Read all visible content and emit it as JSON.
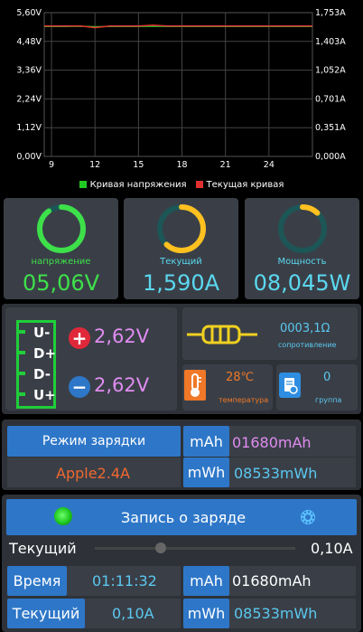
{
  "chart_data": {
    "type": "line",
    "x_ticks": [
      "9",
      "12",
      "15",
      "18",
      "21",
      "24"
    ],
    "xlim": [
      8.5,
      27
    ],
    "left_ticks": [
      "5,60V",
      "4,48V",
      "3,36V",
      "2,24V",
      "1,12V",
      "0,00V"
    ],
    "right_ticks": [
      "1,753A",
      "1,403A",
      "1,052A",
      "0,701A",
      "0,351A",
      "0,000A"
    ],
    "ylim_left": [
      0,
      5.6
    ],
    "ylim_right": [
      0,
      1.753
    ],
    "grid": true,
    "legend": "bottom",
    "series": [
      {
        "name": "Кривая напряжения",
        "color": "#22c822",
        "axis": "left",
        "x": [
          8.5,
          10,
          11,
          12,
          13,
          14,
          15,
          16,
          17,
          18,
          19,
          20,
          21,
          22,
          23,
          24,
          25,
          26,
          27
        ],
        "y": [
          5.06,
          5.06,
          5.07,
          5.05,
          5.06,
          5.06,
          5.06,
          5.07,
          5.06,
          5.06,
          5.06,
          5.06,
          5.06,
          5.06,
          5.06,
          5.06,
          5.06,
          5.06,
          5.06
        ]
      },
      {
        "name": "Текущая кривая",
        "color": "#e03030",
        "axis": "right",
        "x": [
          8.5,
          10,
          11,
          12,
          13,
          14,
          15,
          16,
          17,
          18,
          19,
          20,
          21,
          22,
          23,
          24,
          25,
          26,
          27
        ],
        "y": [
          1.59,
          1.59,
          1.59,
          1.57,
          1.59,
          1.59,
          1.59,
          1.6,
          1.59,
          1.59,
          1.59,
          1.59,
          1.59,
          1.59,
          1.59,
          1.59,
          1.59,
          1.59,
          1.59
        ]
      }
    ]
  },
  "gauges": [
    {
      "label": "напряжение",
      "value": "05,06V",
      "color": "#3ee04a",
      "fraction": 0.9
    },
    {
      "label": "Текущий",
      "value": "1,590A",
      "color": "#ffc020",
      "fraction": 0.62
    },
    {
      "label": "Мощность",
      "value": "08,045W",
      "color": "#ffc020",
      "fraction": 0.12
    }
  ],
  "gauge_value_colors": [
    "#3ee04a",
    "#5bd8f0",
    "#5bd8f0"
  ],
  "pins": [
    "U-",
    "D+",
    "D-",
    "U+"
  ],
  "dplus": "2,62V",
  "dminus": "2,62V",
  "resistance": {
    "value": "0003,1Ω",
    "label": "сопротивление"
  },
  "temperature": {
    "value": "28℃",
    "label": "температура"
  },
  "group": {
    "value": "0",
    "label": "группа"
  },
  "charge_mode": {
    "button": "Режим зарядки",
    "value": "Apple2.4A",
    "mah_label": "mAh",
    "mah_value": "01680mAh",
    "mwh_label": "mWh",
    "mwh_value": "08533mWh"
  },
  "record": {
    "title": "Запись о заряде",
    "current_label": "Текущий",
    "current_value": "0,10A",
    "slider_fraction": 0.33,
    "time_label": "Время",
    "time_value": "01:11:32",
    "mah_label": "mAh",
    "mah_value": "01680mAh",
    "current2_label": "Текущий",
    "current2_value": "0,10A",
    "mwh_label": "mWh",
    "mwh_value": "08533mWh"
  }
}
